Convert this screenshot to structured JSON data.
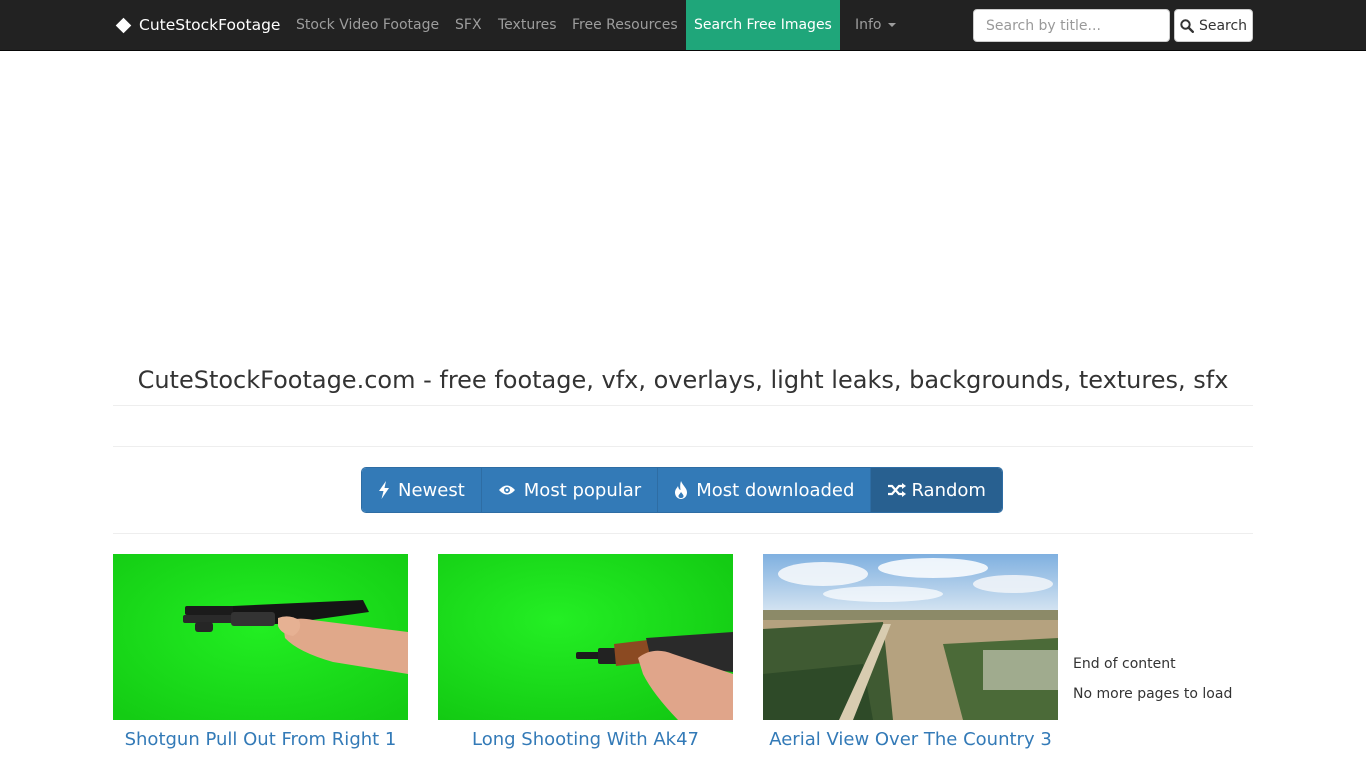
{
  "navbar": {
    "brand": "CuteStockFootage",
    "items": [
      {
        "label": "Stock Video Footage"
      },
      {
        "label": "SFX"
      },
      {
        "label": "Textures"
      },
      {
        "label": "Free Resources"
      },
      {
        "label": "Search Free Images",
        "active": true
      },
      {
        "label": "Info"
      }
    ],
    "search": {
      "placeholder": "Search by title...",
      "button_label": "Search"
    }
  },
  "page": {
    "title": "CuteStockFootage.com - free footage, vfx, overlays, light leaks, backgrounds, textures, sfx"
  },
  "sort": {
    "buttons": [
      {
        "label": "Newest",
        "icon": "bolt-icon"
      },
      {
        "label": "Most popular",
        "icon": "eye-icon"
      },
      {
        "label": "Most downloaded",
        "icon": "fire-icon"
      },
      {
        "label": "Random",
        "icon": "shuffle-icon",
        "active": true
      }
    ]
  },
  "items": [
    {
      "title": "Shotgun Pull Out From Right 1"
    },
    {
      "title": "Long Shooting With Ak47"
    },
    {
      "title": "Aerial View Over The Country 3"
    }
  ],
  "status": {
    "end_of_content": "End of content",
    "no_more_pages": "No more pages to load"
  },
  "colors": {
    "navbar_bg": "#222222",
    "active_nav": "#1fa67a",
    "primary": "#337ab7",
    "primary_active": "#286090",
    "green_screen": "#1ee31e"
  }
}
